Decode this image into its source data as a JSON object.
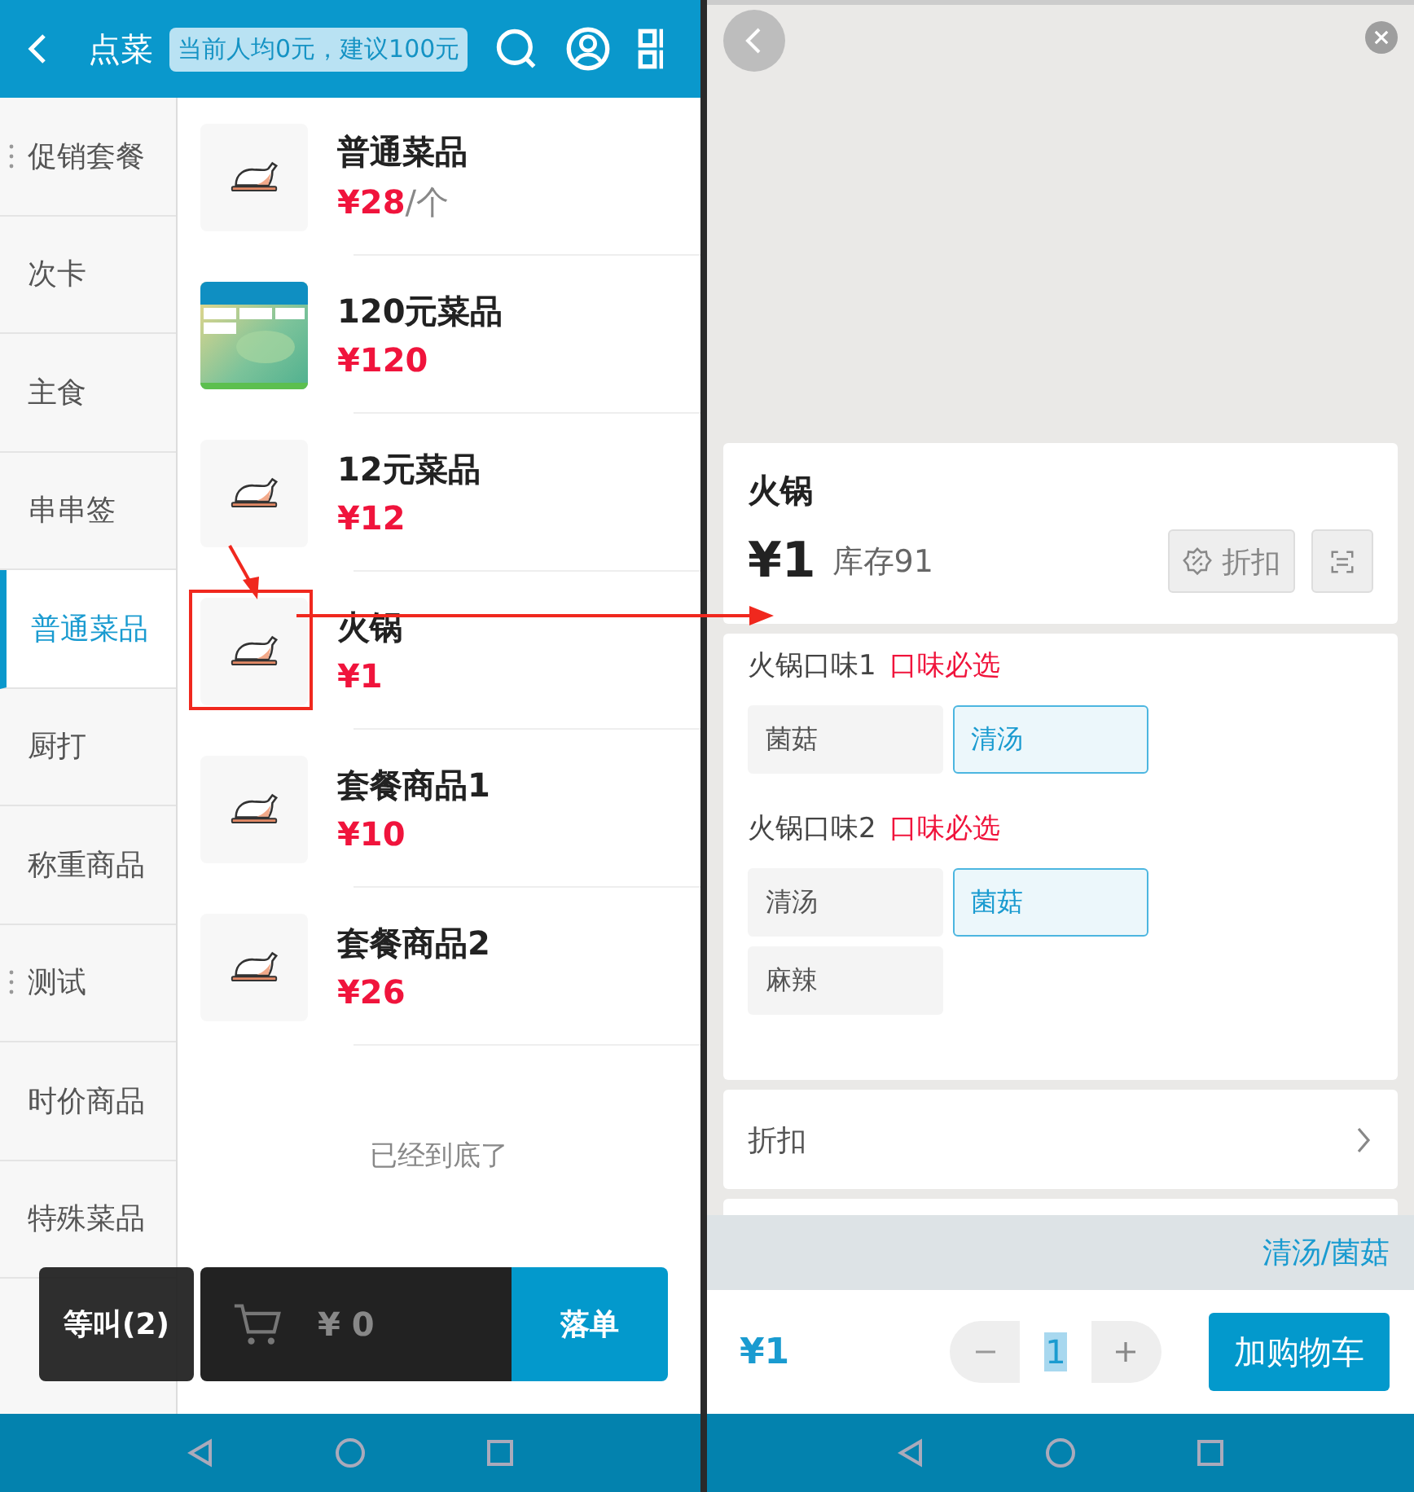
{
  "left_screen": {
    "header": {
      "title": "点菜",
      "budget_hint": "当前人均0元，建议100元"
    },
    "categories": [
      {
        "label": "促销套餐",
        "selected": false,
        "grip": true
      },
      {
        "label": "次卡",
        "selected": false,
        "grip": false
      },
      {
        "label": "主食",
        "selected": false,
        "grip": false
      },
      {
        "label": "串串签",
        "selected": false,
        "grip": false
      },
      {
        "label": "普通菜品",
        "selected": true,
        "grip": false
      },
      {
        "label": "厨打",
        "selected": false,
        "grip": false
      },
      {
        "label": "称重商品",
        "selected": false,
        "grip": false
      },
      {
        "label": "测试",
        "selected": false,
        "grip": true
      },
      {
        "label": "时价商品",
        "selected": false,
        "grip": false
      },
      {
        "label": "特殊菜品",
        "selected": false,
        "grip": false
      }
    ],
    "products": [
      {
        "name": "普通菜品",
        "price": "¥28",
        "unit": "/个",
        "kind": "icon"
      },
      {
        "name": "120元菜品",
        "price": "¥120",
        "kind": "picture"
      },
      {
        "name": "12元菜品",
        "price": "¥12",
        "kind": "icon"
      },
      {
        "name": "火锅",
        "price": "¥1",
        "kind": "icon"
      },
      {
        "name": "套餐商品1",
        "price": "¥10",
        "kind": "icon"
      },
      {
        "name": "套餐商品2",
        "price": "¥26",
        "kind": "icon"
      }
    ],
    "end_note": "已经到底了",
    "bottom_bar": {
      "wait_button": "等叫(2)",
      "cart_total": "¥ 0",
      "submit_button": "落单"
    }
  },
  "right_screen": {
    "product": {
      "name": "火锅",
      "price": "¥1",
      "stock": "库存91",
      "discount_button": "折扣"
    },
    "option_groups": [
      {
        "title": "火锅口味1",
        "required_note": "口味必选",
        "options": [
          {
            "label": "菌菇",
            "selected": false
          },
          {
            "label": "清汤",
            "selected": true
          }
        ]
      },
      {
        "title": "火锅口味2",
        "required_note": "口味必选",
        "options": [
          {
            "label": "清汤",
            "selected": false
          },
          {
            "label": "菌菇",
            "selected": true
          },
          {
            "label": "麻辣",
            "selected": false
          }
        ]
      }
    ],
    "discount_row": "折扣",
    "summary": "清汤/菌菇",
    "footer": {
      "total": "¥1",
      "quantity": "1",
      "add_button": "加购物车"
    }
  }
}
